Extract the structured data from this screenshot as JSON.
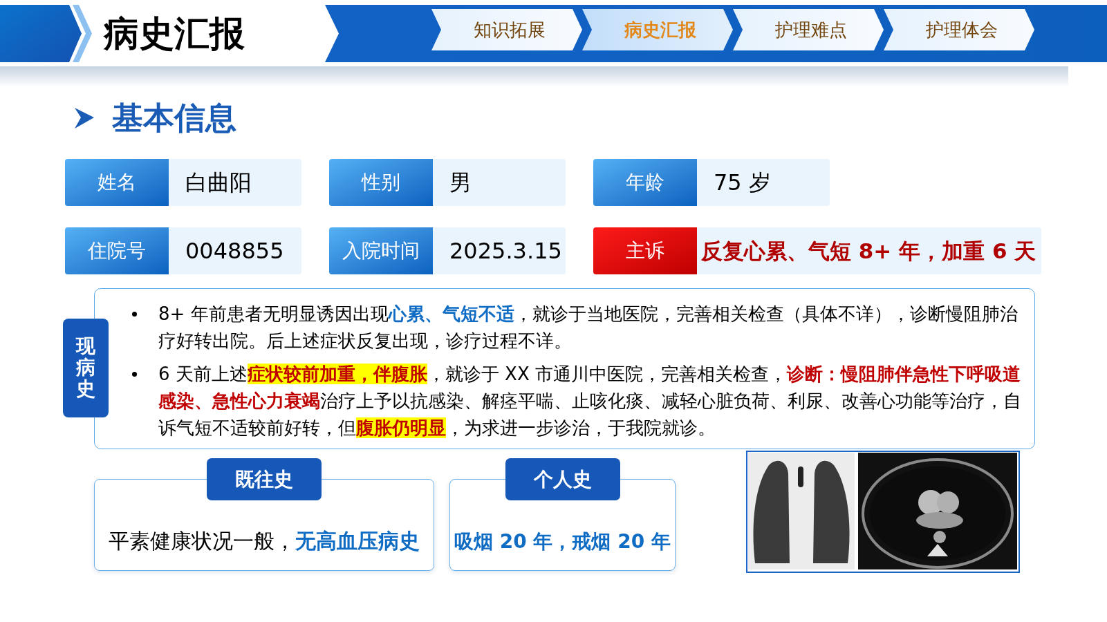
{
  "header": {
    "title": "病史汇报"
  },
  "nav_tabs": [
    {
      "label": "知识拓展",
      "selected": false
    },
    {
      "label": "病史汇报",
      "selected": true
    },
    {
      "label": "护理难点",
      "selected": false
    },
    {
      "label": "护理体会",
      "selected": false
    }
  ],
  "section": {
    "title": "基本信息"
  },
  "info_rows": [
    [
      {
        "label": "姓名",
        "value": "白曲阳",
        "kind": "normal"
      },
      {
        "label": "性别",
        "value": "男",
        "kind": "normal"
      },
      {
        "label": "年龄",
        "value": "75 岁",
        "kind": "normal"
      }
    ],
    [
      {
        "label": "住院号",
        "value": "0048855",
        "kind": "normal"
      },
      {
        "label": "入院时间",
        "value": "2025.3.15",
        "kind": "normal"
      },
      {
        "label": "主诉",
        "value": "反复心累、气短 8+ 年，加重 6 天",
        "kind": "alert"
      }
    ]
  ],
  "present_illness": {
    "title": "现病史",
    "bullets": [
      [
        {
          "text": "8+ 年前患者无明显诱因出现",
          "kind": "plain"
        },
        {
          "text": "心累、气短不适",
          "kind": "blue"
        },
        {
          "text": "，就诊于当地医院，完善相关检查（具体不详），诊断慢阻肺治疗好转出院。后上述症状反复出现，诊疗过程不详。",
          "kind": "plain"
        }
      ],
      [
        {
          "text": "6 天前上述",
          "kind": "plain"
        },
        {
          "text": "症状较前加重，伴腹胀",
          "kind": "highlight"
        },
        {
          "text": "，就诊于 XX 市通川中医院，完善相关检查，",
          "kind": "plain"
        },
        {
          "text": "诊断：慢阻肺伴急性下呼吸道感染、急性心力衰竭",
          "kind": "red"
        },
        {
          "text": "治疗上予以抗感染、解痉平喘、止咳化痰、减轻心脏负荷、利尿、改善心功能等治疗，自诉气短不适较前好转，但",
          "kind": "plain"
        },
        {
          "text": "腹胀仍明显",
          "kind": "highlight"
        },
        {
          "text": "，为求进一步诊治，于我院就诊。",
          "kind": "plain"
        }
      ]
    ]
  },
  "history_cards": [
    {
      "title": "既往史",
      "segments": [
        {
          "text": "平素健康状况一般，",
          "kind": "plain"
        },
        {
          "text": "无高血压病史",
          "kind": "blue"
        }
      ]
    },
    {
      "title": "个人史",
      "segments": [
        {
          "text": "吸烟 20 年，戒烟 20 年",
          "kind": "blue"
        }
      ]
    }
  ]
}
